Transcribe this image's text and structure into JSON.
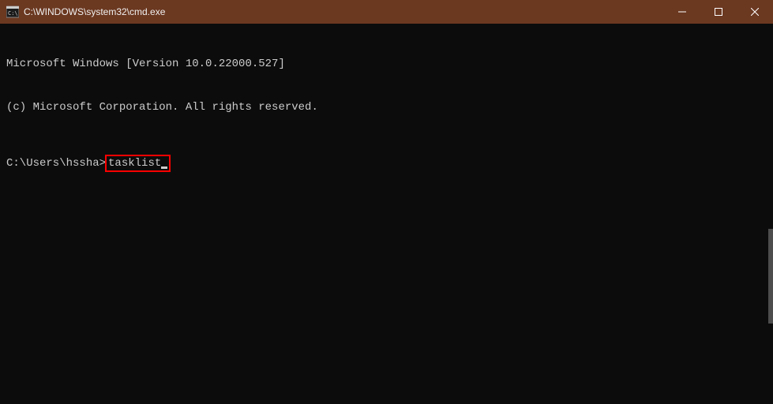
{
  "titlebar": {
    "title": "C:\\WINDOWS\\system32\\cmd.exe"
  },
  "terminal": {
    "line1": "Microsoft Windows [Version 10.0.22000.527]",
    "line2": "(c) Microsoft Corporation. All rights reserved.",
    "prompt": "C:\\Users\\hssha>",
    "command": "tasklist"
  }
}
